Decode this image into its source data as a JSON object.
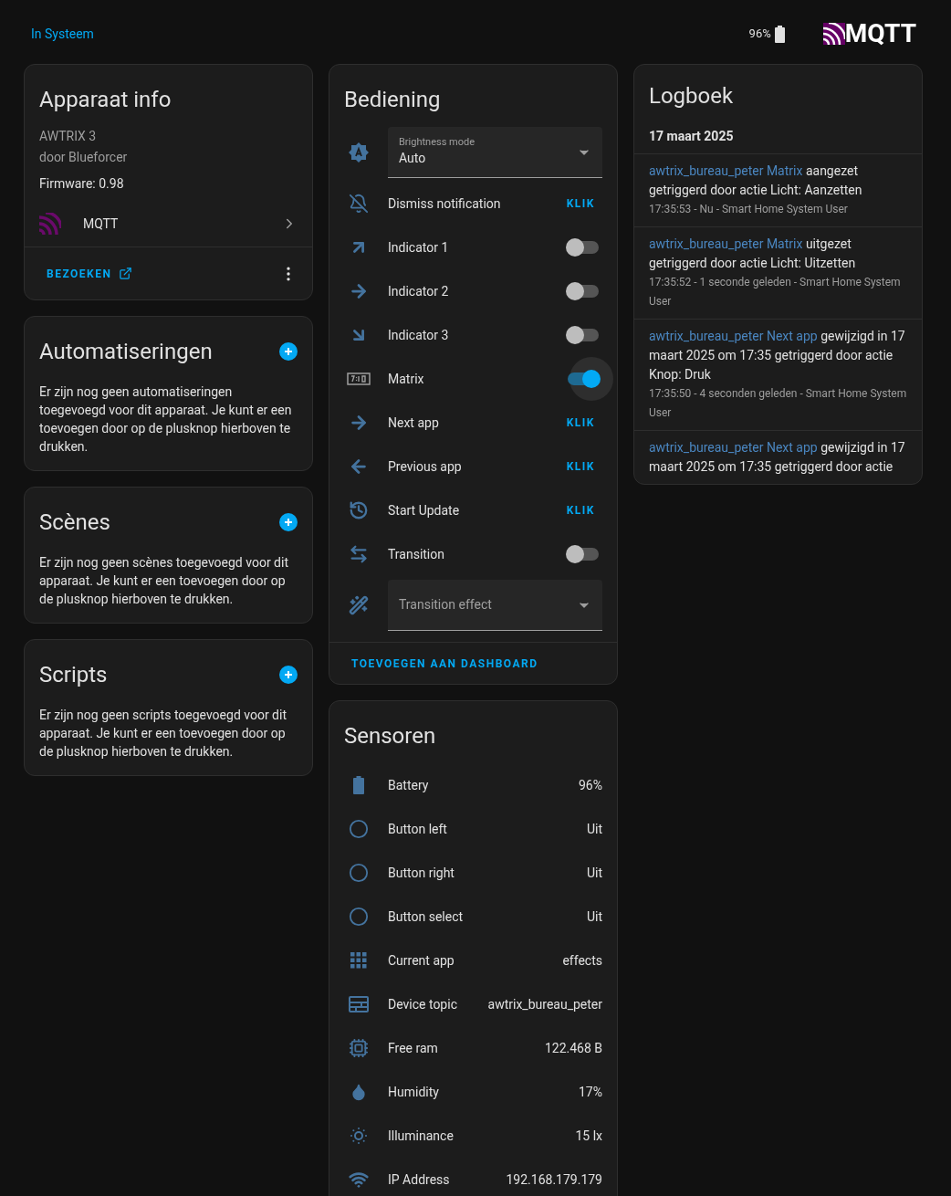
{
  "breadcrumb": "In Systeem",
  "header": {
    "battery": "96%",
    "logo_text": "MQTT"
  },
  "device_info": {
    "title": "Apparaat info",
    "model": "AWTRIX 3",
    "manufacturer": "door Blueforcer",
    "firmware": "Firmware: 0.98",
    "integration": "MQTT",
    "visit": "BEZOEKEN"
  },
  "sections": [
    {
      "title": "Automatiseringen",
      "text": "Er zijn nog geen automatiseringen toegevoegd voor dit apparaat. Je kunt er een toevoegen door op de plusknop hierboven te drukken."
    },
    {
      "title": "Scènes",
      "text": "Er zijn nog geen scènes toegevoegd voor dit apparaat. Je kunt er een toevoegen door op de plusknop hierboven te drukken."
    },
    {
      "title": "Scripts",
      "text": "Er zijn nog geen scripts toegevoegd voor dit apparaat. Je kunt er een toevoegen door op de plusknop hierboven te drukken."
    }
  ],
  "controls_card": {
    "title": "Bediening",
    "footer": "TOEVOEGEN AAN DASHBOARD"
  },
  "controls": [
    {
      "kind": "select",
      "label": "Brightness mode",
      "value": "Auto"
    },
    {
      "kind": "button",
      "name": "Dismiss notification",
      "action": "KLIK"
    },
    {
      "kind": "toggle",
      "name": "Indicator 1",
      "on": false
    },
    {
      "kind": "toggle",
      "name": "Indicator 2",
      "on": false
    },
    {
      "kind": "toggle",
      "name": "Indicator 3",
      "on": false
    },
    {
      "kind": "toggle",
      "name": "Matrix",
      "on": true
    },
    {
      "kind": "button",
      "name": "Next app",
      "action": "KLIK"
    },
    {
      "kind": "button",
      "name": "Previous app",
      "action": "KLIK"
    },
    {
      "kind": "button",
      "name": "Start Update",
      "action": "KLIK"
    },
    {
      "kind": "toggle",
      "name": "Transition",
      "on": false
    },
    {
      "kind": "select",
      "label": "Transition effect"
    }
  ],
  "sensors_card": {
    "title": "Sensoren"
  },
  "sensors": [
    {
      "name": "Battery",
      "value": "96%"
    },
    {
      "name": "Button left",
      "value": "Uit"
    },
    {
      "name": "Button right",
      "value": "Uit"
    },
    {
      "name": "Button select",
      "value": "Uit"
    },
    {
      "name": "Current app",
      "value": "effects"
    },
    {
      "name": "Device topic",
      "value": "awtrix_bureau_peter"
    },
    {
      "name": "Free ram",
      "value": "122.468 B"
    },
    {
      "name": "Humidity",
      "value": "17%"
    },
    {
      "name": "Illuminance",
      "value": "15 lx"
    },
    {
      "name": "IP Address",
      "value": "192.168.179.179"
    }
  ],
  "logbook": {
    "title": "Logboek",
    "date": "17 maart 2025",
    "entries": [
      {
        "entity": "awtrix_bureau_peter Matrix",
        "message": "aangezet getriggerd door actie Licht: Aanzetten",
        "meta": "17:35:53 - Nu - Smart Home System User"
      },
      {
        "entity": "awtrix_bureau_peter Matrix",
        "message": "uitgezet getriggerd door actie Licht: Uitzetten",
        "meta": "17:35:52 - 1 seconde geleden - Smart Home System User"
      },
      {
        "entity": "awtrix_bureau_peter Next app",
        "message": "gewijzigd in 17 maart 2025 om 17:35 getriggerd door actie Knop: Druk",
        "meta": "17:35:50 - 4 seconden geleden - Smart Home System User"
      },
      {
        "entity": "awtrix_bureau_peter Next app",
        "message": "gewijzigd in 17 maart 2025 om 17:35 getriggerd door actie"
      }
    ]
  }
}
